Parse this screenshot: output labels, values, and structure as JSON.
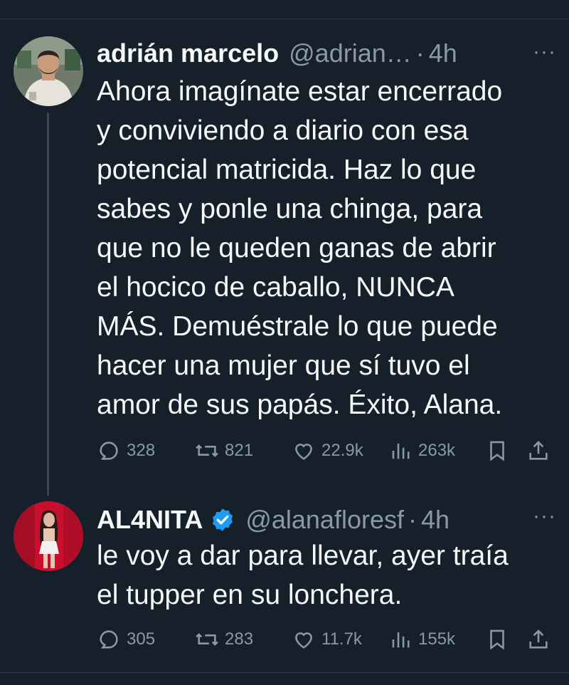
{
  "tweets": [
    {
      "name": "adrián marcelo",
      "handle": "@adrian…",
      "separator": "·",
      "time": "4h",
      "more": "···",
      "text": "Ahora imagínate estar encerrado\ny conviviendo a diario con esa\npotencial matricida. Haz lo que\nsabes y ponle una chinga, para\nque no le queden ganas de abrir\nel hocico de caballo, NUNCA\nMÁS. Demuéstrale lo que puede\nhacer una mujer que sí tuvo el\namor de sus papás. Éxito, Alana.",
      "replies": "328",
      "retweets": "821",
      "likes": "22.9k",
      "views": "263k"
    },
    {
      "name": "AL4NITA",
      "verified": true,
      "handle": "@alanafloresf",
      "separator": "·",
      "time": "4h",
      "more": "···",
      "text": "le voy a dar para llevar, ayer traía\nel tupper en su lonchera.",
      "replies": "305",
      "retweets": "283",
      "likes": "11.7k",
      "views": "155k"
    }
  ],
  "colors": {
    "background": "#15202b",
    "text": "#f7f9f9",
    "secondary": "#8b98a5",
    "verified": "#1d9bf0"
  }
}
